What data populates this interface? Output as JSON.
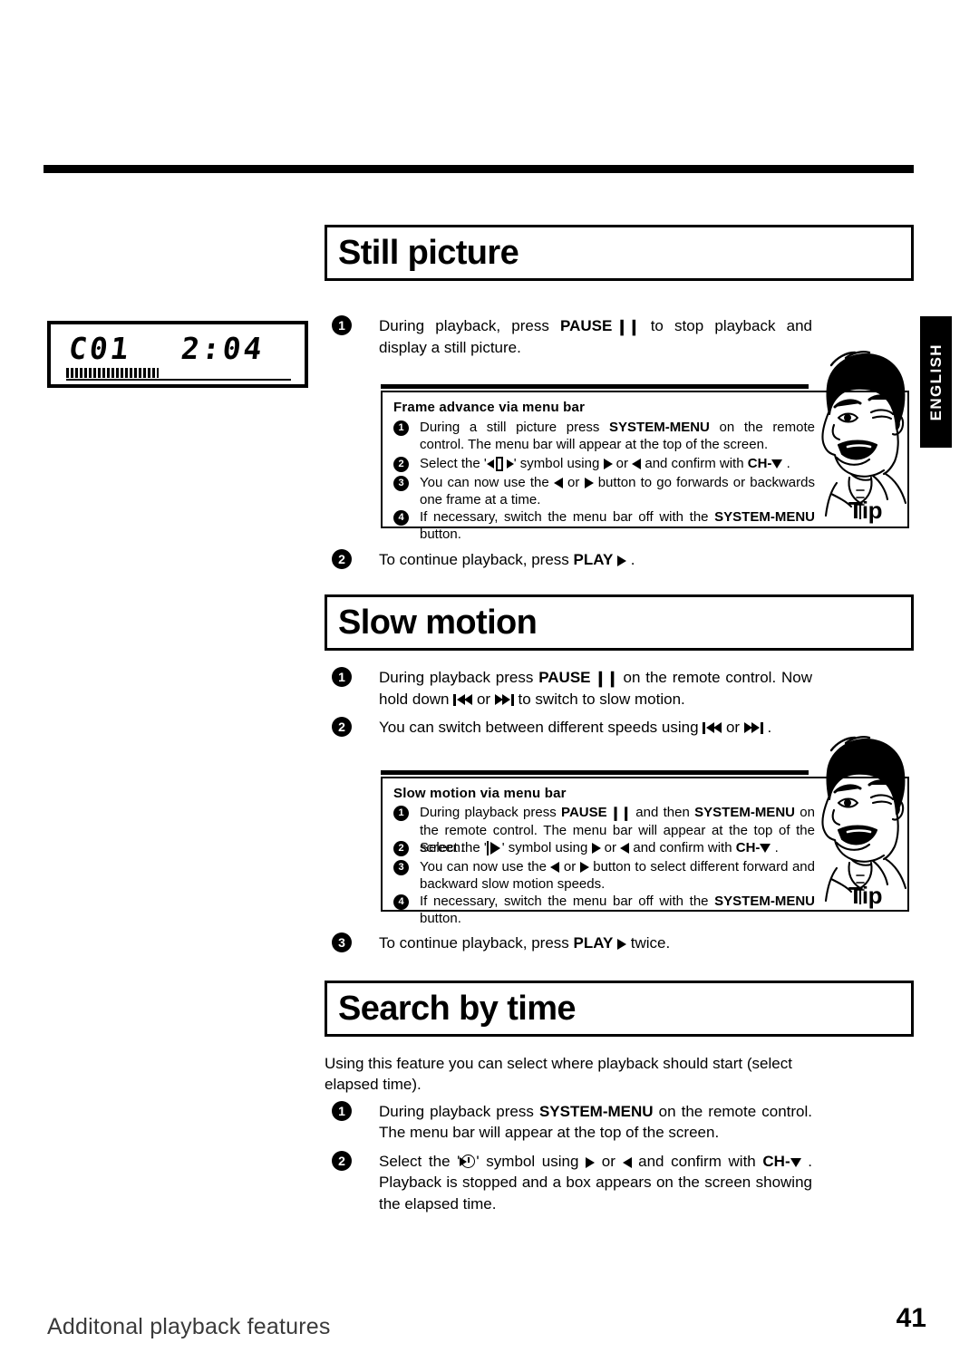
{
  "page": {
    "language_tab": "ENGLISH",
    "footer_title": "Additonal playback features",
    "footer_page_number": "41"
  },
  "lcd_display": {
    "chapter": "C01",
    "time": "2:04",
    "progress_percent": 41
  },
  "sections": [
    {
      "id": "still-picture",
      "heading": "Still picture",
      "steps": [
        {
          "number": "1",
          "text_before": "During playback, press ",
          "bold": "PAUSE",
          "icon": "pause-icon",
          "text_after": " to stop playback and display a still picture."
        },
        {
          "number": "2",
          "text_before": "To continue playback, press ",
          "bold": "PLAY",
          "icon": "play-icon",
          "text_after": " ."
        }
      ],
      "tip": {
        "title": "Frame advance via menu bar",
        "label": "Tip",
        "steps": [
          {
            "number": "1",
            "text": "During a still picture press SYSTEM-MENU on the remote control. The menu bar will appear at the top of the screen."
          },
          {
            "number": "2",
            "text": "Select the '[frame]' symbol using > or < and confirm with CH- v ."
          },
          {
            "number": "3",
            "text": "You can now use the < or > button to go forwards or backwards one frame at a time."
          },
          {
            "number": "4",
            "text": "If necessary, switch the menu bar off with the SYSTEM-MENU button."
          }
        ]
      }
    },
    {
      "id": "slow-motion",
      "heading": "Slow motion",
      "steps": [
        {
          "number": "1",
          "text": "During playback press PAUSE on the remote control. Now hold down |<< or >>| to switch to slow motion."
        },
        {
          "number": "2",
          "text": "You can switch between different speeds using |<< or >>| ."
        },
        {
          "number": "3",
          "text": "To continue playback, press PLAY > twice."
        }
      ],
      "tip": {
        "title": "Slow motion via menu bar",
        "label": "Tip",
        "steps": [
          {
            "number": "1",
            "text": "During playback press PAUSE and then SYSTEM-MENU on the remote control. The menu bar will appear at the top of the screen."
          },
          {
            "number": "2",
            "text": "Select the '[slow]' symbol using > or < and confirm with CH- v ."
          },
          {
            "number": "3",
            "text": "You can now use the < or > button to select different forward and backward slow motion speeds."
          },
          {
            "number": "4",
            "text": "If necessary, switch the menu bar off with the SYSTEM-MENU button."
          }
        ]
      }
    },
    {
      "id": "search-by-time",
      "heading": "Search by time",
      "intro": "Using this feature you can select where playback should start (select elapsed time).",
      "steps": [
        {
          "number": "1",
          "text": "During playback press SYSTEM-MENU on the remote control. The menu bar will appear at the top of the screen."
        },
        {
          "number": "2",
          "text": "Select the '[clock]' symbol using > or < and confirm with CH- v . Playback is stopped and a box appears on the screen showing the elapsed time."
        }
      ]
    }
  ],
  "labels": {
    "pause": "PAUSE",
    "play": "PLAY",
    "system_menu": "SYSTEM-MENU",
    "ch_minus": "CH-",
    "tip": "Tip"
  },
  "text": {
    "still_step1_a": "During playback, press ",
    "still_step1_b": " to stop playback and display a still picture.",
    "still_step2_a": "To continue playback, press ",
    "still_step2_b": " .",
    "tip1_title": "Frame advance via menu bar",
    "tip1_s1_a": "During a still picture press ",
    "tip1_s1_b": " on the remote control. The menu bar will appear at the top of the screen.",
    "tip1_s2_a": "Select the '",
    "tip1_s2_b": "' symbol using ",
    "tip1_s2_c": " or ",
    "tip1_s2_d": " and confirm with ",
    "tip1_s2_e": " .",
    "tip1_s3_a": "You can now use the ",
    "tip1_s3_b": " or ",
    "tip1_s3_c": " button to go forwards or backwards one frame at a time.",
    "tip1_s4_a": "If necessary, switch the menu bar off with the ",
    "tip1_s4_b": " button.",
    "slow_s1_a": "During playback press ",
    "slow_s1_b": " on the remote control. Now hold down ",
    "slow_s1_c": " or ",
    "slow_s1_d": " to switch to slow motion.",
    "slow_s2_a": "You can switch between different speeds using ",
    "slow_s2_b": " or ",
    "slow_s2_c": " .",
    "slow_s3_a": "To continue playback, press ",
    "slow_s3_b": " twice.",
    "tip2_title": "Slow motion via menu bar",
    "tip2_s1_a": "During playback press ",
    "tip2_s1_b": " and then ",
    "tip2_s1_c": " on the remote control. The menu bar will appear at the top of the screen.",
    "tip2_s2_a": "Select the '",
    "tip2_s2_b": "' symbol using ",
    "tip2_s2_c": " or ",
    "tip2_s2_d": " and confirm with ",
    "tip2_s2_e": " .",
    "tip2_s3_a": "You can now use the ",
    "tip2_s3_b": " or ",
    "tip2_s3_c": " button to select different forward and backward slow motion speeds.",
    "tip2_s4_a": "If necessary, switch the menu bar off with the ",
    "tip2_s4_b": " button.",
    "search_intro": "Using this feature you can select where playback should start (select elapsed time).",
    "search_s1_a": "During playback press ",
    "search_s1_b": " on the remote control. The menu bar will appear at the top of the screen.",
    "search_s2_a": "Select the '",
    "search_s2_b": "' symbol using ",
    "search_s2_c": " or ",
    "search_s2_d": " and confirm with ",
    "search_s2_e": " . Playback is stopped and a box appears on the screen showing the elapsed time."
  }
}
